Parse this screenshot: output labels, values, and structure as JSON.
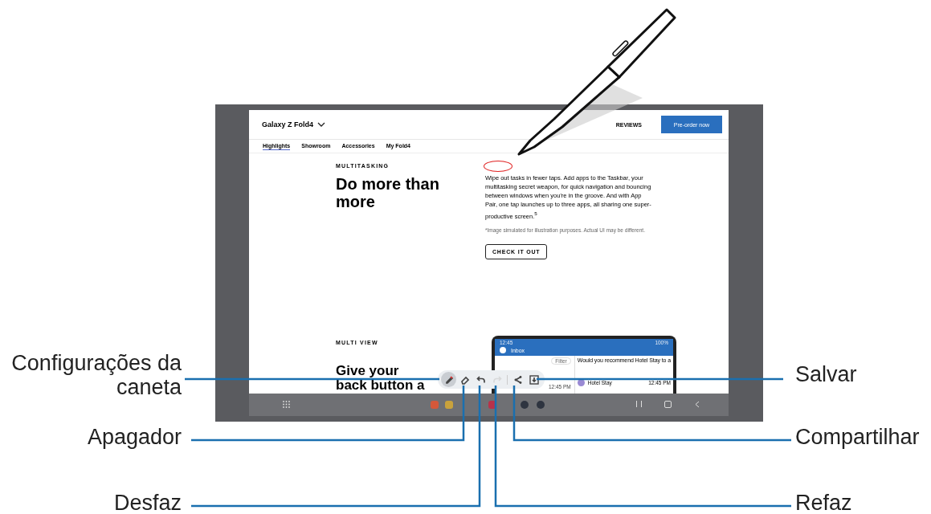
{
  "callouts": [
    {
      "label": "Configurações da\ncaneta"
    },
    {
      "label": "Salvar"
    },
    {
      "label": "Apagador"
    },
    {
      "label": "Compartilhar"
    },
    {
      "label": "Desfaz"
    },
    {
      "label": "Refaz"
    }
  ],
  "site": {
    "product": "Galaxy Z Fold4",
    "reviews": "REVIEWS",
    "cta": "Pre-order now",
    "tabs": [
      {
        "label": "Highlights",
        "selected": true
      },
      {
        "label": "Showroom",
        "selected": false
      },
      {
        "label": "Accessories",
        "selected": false
      },
      {
        "label": "My Fold4",
        "selected": false
      }
    ],
    "eyebrow": "MULTITASKING",
    "heading": "Do more than more",
    "body": "Wipe out tasks in fewer taps. Add apps to the Taskbar, your multitasking secret weapon, for quick navigation and bouncing between windows when you're in the groove. And with App Pair, one tap launches up to three apps, all sharing one super-productive screen.$^{5}$",
    "note": "*Image simulated for illustration purposes. Actual UI may be different.",
    "button": "CHECK IT OUT",
    "eyebrow2": "MULTI VIEW",
    "heading2": "Give your back button a"
  },
  "phone": {
    "time": "12:45",
    "battery": "100%",
    "title": "Inbox",
    "filter": "Filter",
    "subject": "Would you recommend Hotel Stay to a",
    "mail_time": "12:45 PM",
    "sender": "Hotel Stay",
    "sender_time": "12:45 PM"
  },
  "toolbar": [
    {
      "kind": "pen",
      "selected": true,
      "disabled": false
    },
    {
      "kind": "eraser",
      "selected": false,
      "disabled": false
    },
    {
      "kind": "undo",
      "selected": false,
      "disabled": false
    },
    {
      "kind": "redo",
      "selected": false,
      "disabled": true
    },
    {
      "kind": "share",
      "selected": false,
      "disabled": false
    },
    {
      "kind": "save",
      "selected": false,
      "disabled": false
    }
  ]
}
